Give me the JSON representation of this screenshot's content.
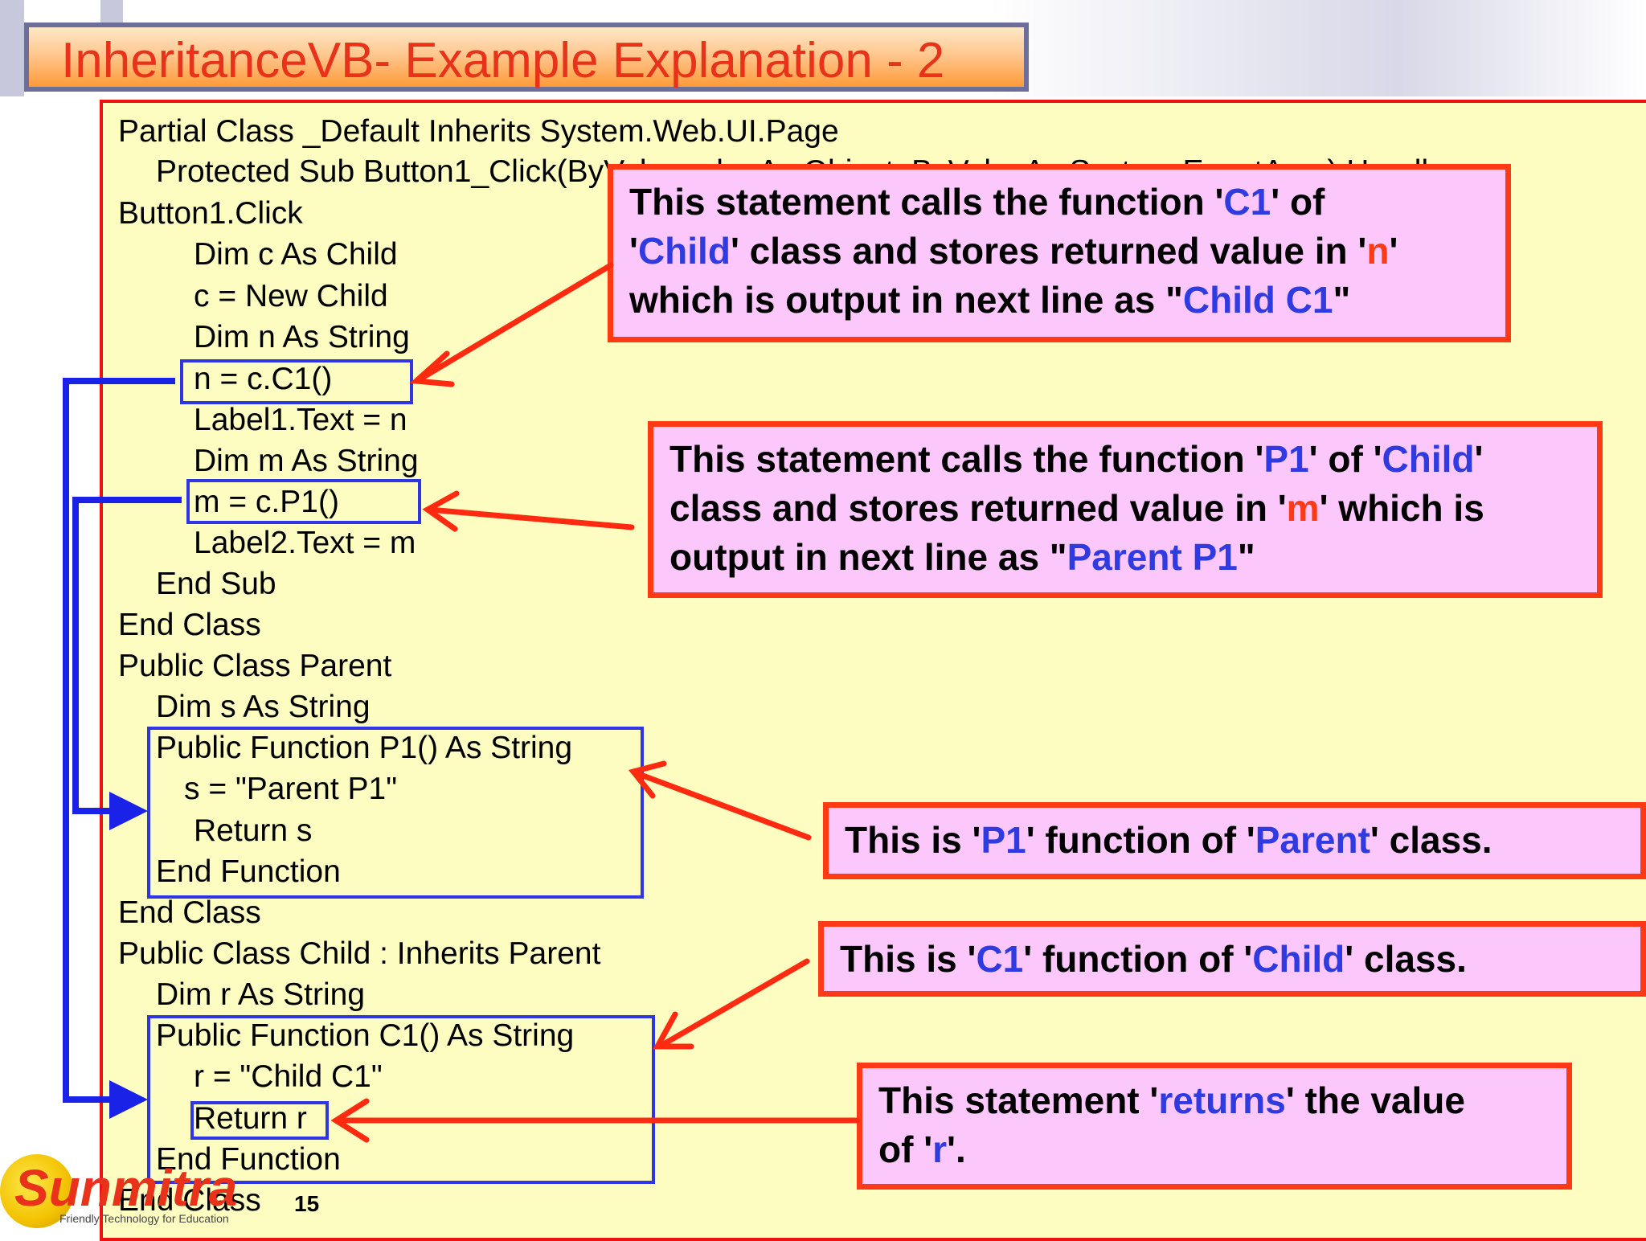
{
  "slide": {
    "title": "InheritanceVB- Example Explanation - 2",
    "number": "15"
  },
  "code_lines": [
    "Partial Class _Default Inherits System.Web.UI.Page",
    "Protected Sub Button1_Click(ByVal sender As Object, ByVal e As System.EventArgs) Handles",
    "Button1.Click",
    "Dim c As Child",
    "c = New Child",
    "Dim n As String",
    "n = c.C1()",
    "Label1.Text = n",
    "Dim m As String",
    "m = c.P1()",
    "Label2.Text = m",
    "End Sub",
    "End Class",
    "Public Class Parent",
    "Dim s As String",
    "Public Function P1() As String",
    "s = \"Parent P1\"",
    "Return s",
    "End Function",
    "End Class",
    "Public Class Child : Inherits Parent",
    "Dim r As String",
    "Public Function C1() As String",
    "r = \"Child C1\"",
    "Return r",
    "End Function",
    "End Class"
  ],
  "callouts": {
    "c1_call": {
      "t1": "This statement calls the function '",
      "k1": "C1",
      "t2": "' of",
      "t3": "'",
      "k2": "Child",
      "t4": "' class and stores returned value in '",
      "k3": "n",
      "t5": "'",
      "t6": "which is output in next line as \"",
      "k4": "Child C1",
      "t7": "\""
    },
    "p1_call": {
      "t1": "This statement calls the function '",
      "k1": "P1",
      "t2": "' of '",
      "k2": "Child",
      "t3": "'",
      "t4": "class and stores returned value in '",
      "k3": "m",
      "t5": "' which is",
      "t6": "output in next line as \"",
      "k4": "Parent P1",
      "t7": "\""
    },
    "p1_def": {
      "t1": "This is '",
      "k1": "P1",
      "t2": "' function of '",
      "k2": "Parent",
      "t3": "' class."
    },
    "c1_def": {
      "t1": "This is '",
      "k1": "C1",
      "t2": "' function of '",
      "k2": "Child",
      "t3": "' class."
    },
    "return_r": {
      "t1": "This statement '",
      "k1": "returns",
      "t2": "' the value",
      "t3": "of '",
      "k2": "r",
      "t4": "'."
    }
  },
  "logo": {
    "brand": "Sunmitra",
    "tagline": "Friendly Technology for Education"
  },
  "colors": {
    "arrow_red": "#ff2a10",
    "arrow_blue": "#1a22e8"
  }
}
